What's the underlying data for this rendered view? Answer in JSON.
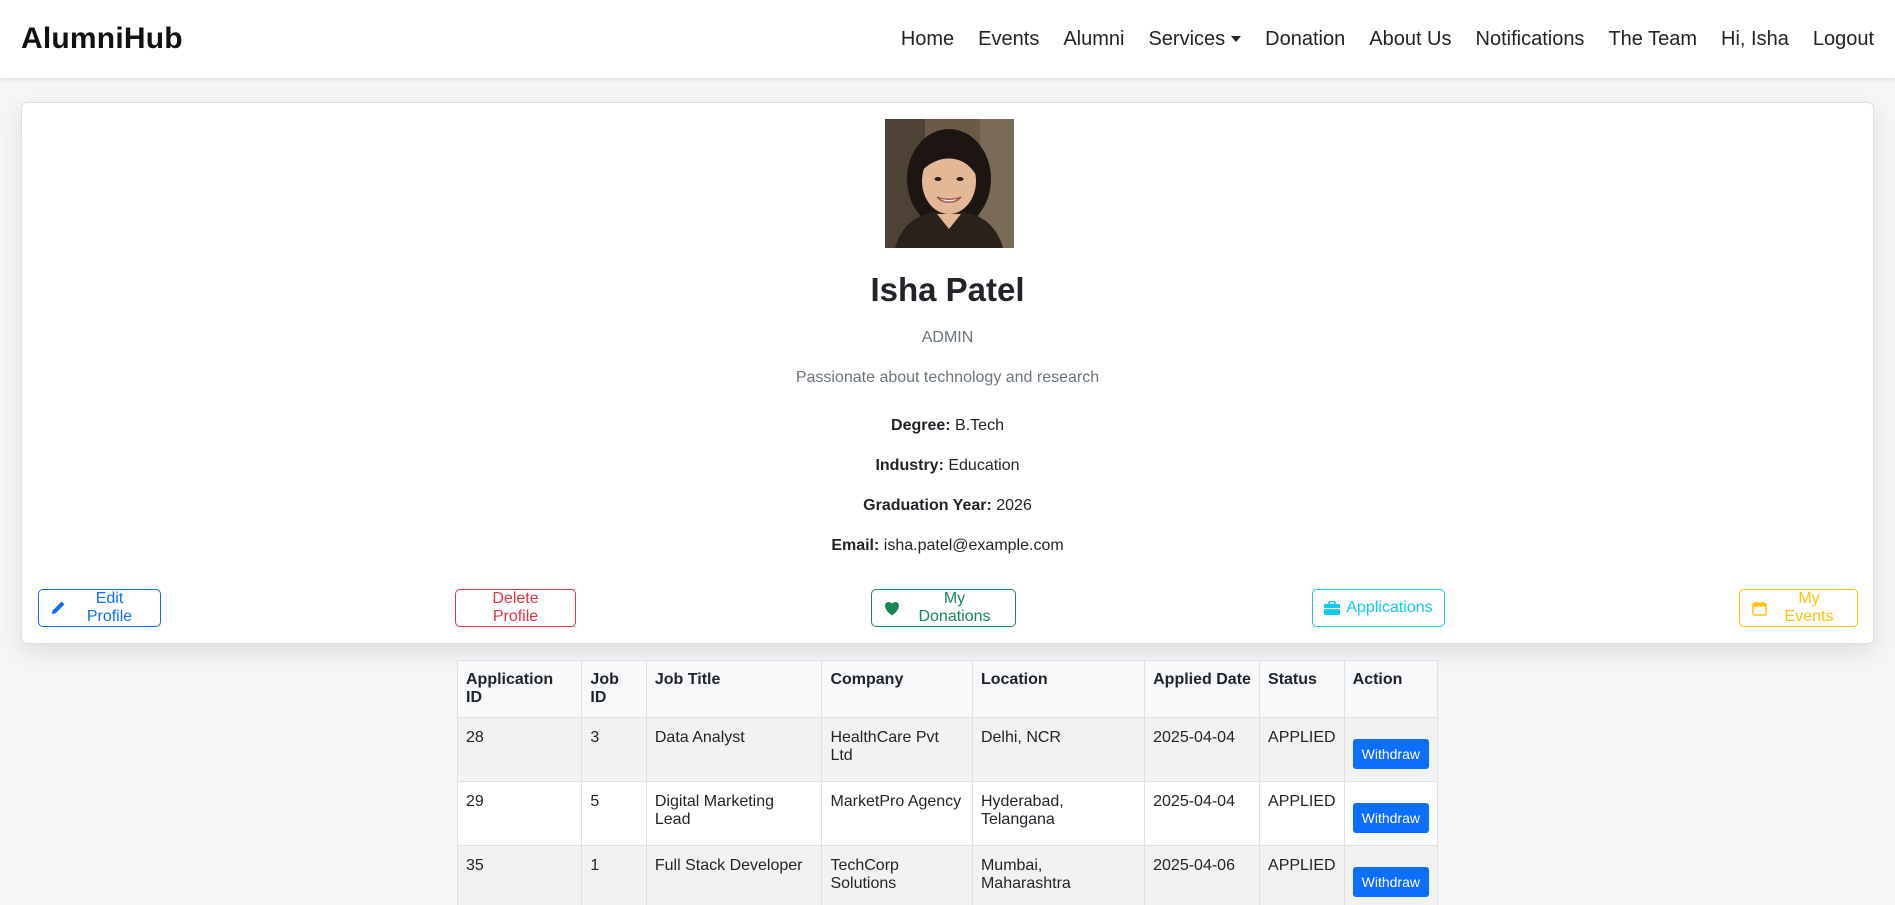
{
  "navbar": {
    "brand": "AlumniHub",
    "items": [
      {
        "label": "Home"
      },
      {
        "label": "Events"
      },
      {
        "label": "Alumni"
      },
      {
        "label": "Services"
      },
      {
        "label": "Donation"
      },
      {
        "label": "About Us"
      },
      {
        "label": "Notifications"
      },
      {
        "label": "The Team"
      },
      {
        "label": "Hi, Isha"
      },
      {
        "label": "Logout"
      }
    ]
  },
  "profile": {
    "name": "Isha Patel",
    "role": "ADMIN",
    "bio": "Passionate about technology and research",
    "details": {
      "degree_label": "Degree:",
      "degree": "B.Tech",
      "industry_label": "Industry:",
      "industry": "Education",
      "grad_label": "Graduation Year:",
      "grad_year": "2026",
      "email_label": "Email:",
      "email": "isha.patel@example.com"
    },
    "actions": {
      "edit": "Edit Profile",
      "delete": "Delete Profile",
      "donations": "My Donations",
      "applications": "Applications",
      "events": "My Events"
    }
  },
  "applications_table": {
    "headers": [
      "Application ID",
      "Job ID",
      "Job Title",
      "Company",
      "Location",
      "Applied Date",
      "Status",
      "Action"
    ],
    "rows": [
      {
        "app_id": "28",
        "job_id": "3",
        "title": "Data Analyst",
        "company": "HealthCare Pvt Ltd",
        "location": "Delhi, NCR",
        "date": "2025-04-04",
        "status": "APPLIED",
        "action": "Withdraw"
      },
      {
        "app_id": "29",
        "job_id": "5",
        "title": "Digital Marketing Lead",
        "company": "MarketPro Agency",
        "location": "Hyderabad, Telangana",
        "date": "2025-04-04",
        "status": "APPLIED",
        "action": "Withdraw"
      },
      {
        "app_id": "35",
        "job_id": "1",
        "title": "Full Stack Developer",
        "company": "TechCorp Solutions",
        "location": "Mumbai, Maharashtra",
        "date": "2025-04-06",
        "status": "APPLIED",
        "action": "Withdraw"
      }
    ]
  },
  "colors": {
    "primary": "#0d6efd",
    "danger": "#dc3545",
    "success": "#198754",
    "info": "#0dcaf0",
    "warning": "#ffc107"
  }
}
